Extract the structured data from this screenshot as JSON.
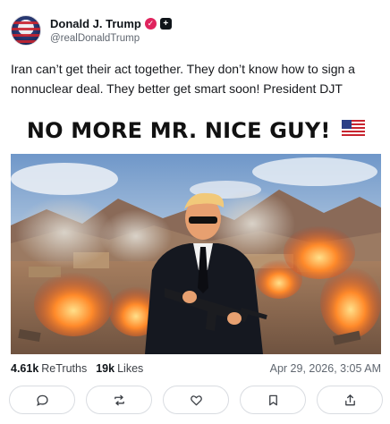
{
  "post": {
    "author": {
      "display_name": "Donald J. Trump",
      "handle": "@realDonaldTrump",
      "verified_badge_color": "#e0245e"
    },
    "text": "Iran can’t get their act together. They don’t know how to sign a nonnuclear deal. They better get smart soon! President DJT",
    "media": {
      "headline": "NO MORE MR. NICE GUY!",
      "headline_emoji": "us-flag-icon"
    },
    "stats": {
      "retruths_count": "4.61k",
      "retruths_label": "ReTruths",
      "likes_count": "19k",
      "likes_label": "Likes"
    },
    "timestamp": "Apr 29, 2026, 3:05 AM"
  },
  "actions": [
    {
      "name": "reply",
      "icon": "comment-icon"
    },
    {
      "name": "retruth",
      "icon": "repost-icon"
    },
    {
      "name": "like",
      "icon": "heart-icon"
    },
    {
      "name": "bookmark",
      "icon": "bookmark-icon"
    },
    {
      "name": "share",
      "icon": "share-icon"
    }
  ],
  "colors": {
    "text": "#16181c",
    "muted": "#606770",
    "border": "#d9dce1"
  }
}
